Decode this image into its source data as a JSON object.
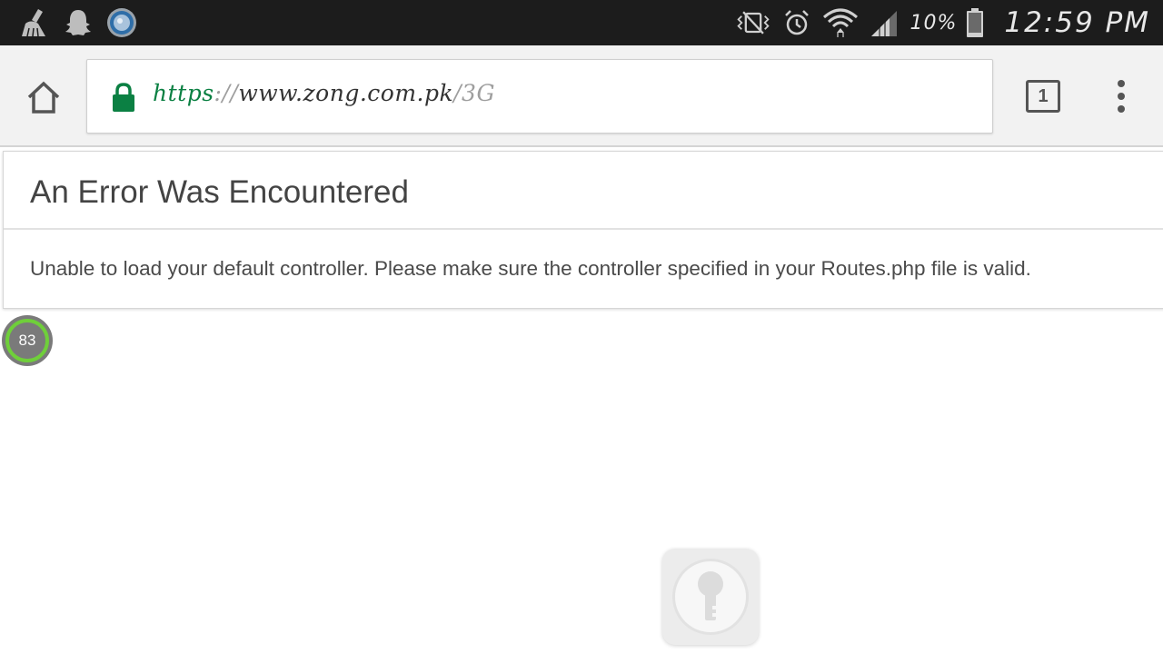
{
  "status_bar": {
    "left_icons": [
      "cleaner-broom-icon",
      "snapchat-ghost-icon",
      "circular-app-icon"
    ],
    "right_icons": [
      "vibrate-mode-icon",
      "alarm-clock-icon",
      "wifi-icon",
      "cellular-signal-icon",
      "battery-icon"
    ],
    "battery_percent": "10%",
    "time": "12:59 PM"
  },
  "toolbar": {
    "url": {
      "scheme": "https",
      "separator": "://",
      "host": "www.zong.com.pk",
      "path": "/3G"
    },
    "tab_count": "1",
    "icons": [
      "home-icon",
      "lock-icon",
      "tabs-icon",
      "overflow-menu-icon"
    ]
  },
  "error": {
    "title": "An Error Was Encountered",
    "message": "Unable to load your default controller. Please make sure the controller specified in your Routes.php file is valid."
  },
  "overlays": {
    "score_badge_value": "83",
    "key_bubble_icon": "key-icon"
  },
  "colors": {
    "status_bar_bg": "#1c1c1c",
    "toolbar_bg": "#f2f2f2",
    "secure_green": "#0b8043",
    "ring_green": "#6fcf3a",
    "text_dark": "#444444"
  }
}
